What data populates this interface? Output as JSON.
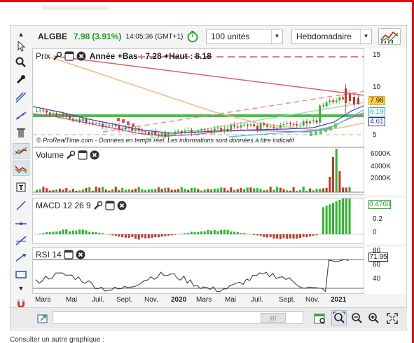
{
  "header": {
    "symbol": "ALGBE",
    "price": "7.98",
    "change": "(3.91%)",
    "time": "14:05:36 (GMT+1)",
    "quantity": "100 unités",
    "period": "Hebdomadaire"
  },
  "price_panel": {
    "title": "Prix",
    "annotation": "Année +Bas : 7.28 +Haut : 8.18",
    "watermark": "© ProRealTime.com - Données en temps réel. Les informations sont données à titre indicatif",
    "ticks": [
      "15",
      "10",
      "5"
    ],
    "tags": [
      "7.98",
      "6.19",
      "4.61"
    ]
  },
  "volume_panel": {
    "title": "Volume",
    "ticks": [
      "6000K",
      "4000K",
      "2000K"
    ]
  },
  "macd_panel": {
    "title": "MACD 12 26 9",
    "ticks": [
      "0.4",
      "0.2",
      "0"
    ],
    "tag": "0.4760"
  },
  "rsi_panel": {
    "title": "RSI 14",
    "ticks": [
      "80",
      "60",
      "40"
    ],
    "tag": "71.95"
  },
  "x_axis": [
    "Mars",
    "Mai",
    "Juil.",
    "Sept.",
    "Nov.",
    "2020",
    "Mars",
    "Mai",
    "Juil.",
    "Sept.",
    "Nov.",
    "2021"
  ],
  "footer": "Consulter un autre graphique :",
  "colors": {
    "up": "#2fb52f",
    "down": "#c0392b",
    "accent": "#e30613",
    "volume": "#c0392b",
    "macd": "#2fb52f",
    "rsi_line": "#333333"
  }
}
